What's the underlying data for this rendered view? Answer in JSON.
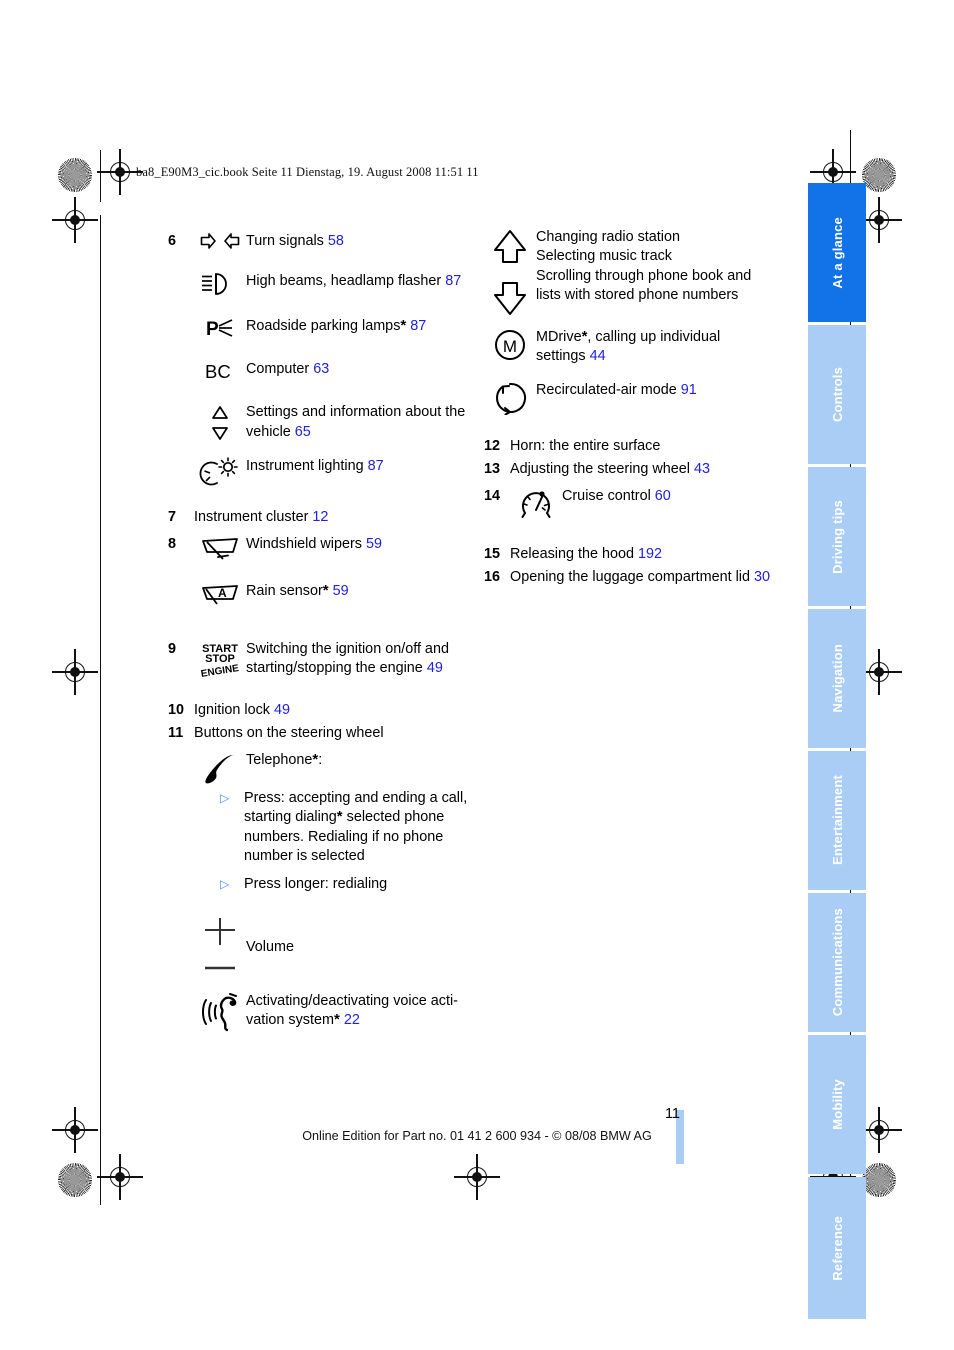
{
  "header": {
    "file_line": "ba8_E90M3_cic.book  Seite 11  Dienstag, 19. August 2008  11:51 11"
  },
  "sidebar": {
    "tabs": [
      {
        "label": "At a glance",
        "active": true
      },
      {
        "label": "Controls",
        "active": false
      },
      {
        "label": "Driving tips",
        "active": false
      },
      {
        "label": "Navigation",
        "active": false
      },
      {
        "label": "Entertainment",
        "active": false
      },
      {
        "label": "Communications",
        "active": false
      },
      {
        "label": "Mobility",
        "active": false
      },
      {
        "label": "Reference",
        "active": false
      }
    ],
    "active_color": "#1272e8",
    "inactive_color": "#a9cdf5",
    "label_color": "#ffffff"
  },
  "left_column": {
    "items": [
      {
        "number": "6",
        "icon": "turn-signals-icon",
        "text": "Turn signals",
        "page": "58"
      },
      {
        "number": "",
        "icon": "high-beams-icon",
        "text": "High beams, headlamp flasher",
        "page": "87"
      },
      {
        "number": "",
        "icon": "roadside-parking-lamps-icon",
        "text": "Roadside parking lamps",
        "starred": true,
        "page": "87"
      },
      {
        "number": "",
        "icon": "bc-computer-icon",
        "text": "Computer",
        "page": "63"
      },
      {
        "number": "",
        "icon": "up-down-triangles-icon",
        "text": "Settings and information about the vehicle",
        "page": "65"
      },
      {
        "number": "",
        "icon": "instrument-lighting-icon",
        "text": "Instrument lighting",
        "page": "87"
      },
      {
        "number": "7",
        "icon": "",
        "text": "Instrument cluster",
        "page": "12"
      },
      {
        "number": "8",
        "icon": "windshield-wipers-icon",
        "text": "Windshield wipers",
        "page": "59"
      },
      {
        "number": "",
        "icon": "rain-sensor-icon",
        "text": "Rain sensor",
        "starred": true,
        "page": "59"
      },
      {
        "number": "9",
        "icon": "start-stop-engine-icon",
        "text": "Switching the ignition on/off and starting/stopping the engine",
        "page": "49"
      },
      {
        "number": "10",
        "icon": "",
        "text": "Ignition lock",
        "page": "49"
      },
      {
        "number": "11",
        "icon": "",
        "text": "Buttons on the steering wheel",
        "page": ""
      }
    ],
    "telephone": {
      "icon": "telephone-handset-icon",
      "label": "Telephone",
      "starred": true,
      "bullets": [
        {
          "marker": "▷",
          "text_part1": "Press: accepting and ending a call, starting dialing",
          "starred": true,
          "text_part2": " selected phone numbers. Redialing if no phone number is selected"
        },
        {
          "marker": "▷",
          "text_part1": "Press longer: redialing",
          "starred": false,
          "text_part2": ""
        }
      ]
    },
    "volume": {
      "icon": "plus-minus-volume-icon",
      "text": "Volume"
    },
    "voice": {
      "icon": "voice-activation-icon",
      "text": "Activating/deactivating voice acti-vation system",
      "text_line1": "Activating/deactivating voice acti-",
      "text_line2": "vation system",
      "starred": true,
      "page": "22"
    }
  },
  "right_column": {
    "arrows": {
      "icon_up": "arrow-up-icon",
      "icon_down": "arrow-down-icon",
      "lines": [
        "Changing radio station",
        "Selecting music track",
        "Scrolling through phone book and",
        "lists with stored phone numbers"
      ]
    },
    "mdrive": {
      "icon": "mdrive-m-circle-icon",
      "text_line1": "MDrive",
      "starred": true,
      "text_line1b": ", calling up individual",
      "text_line2": "settings",
      "page": "44"
    },
    "recirculation": {
      "icon": "recirculated-air-icon",
      "text": "Recirculated-air mode",
      "page": "91"
    },
    "items": [
      {
        "number": "12",
        "icon": "",
        "text": "Horn: the entire surface",
        "page": ""
      },
      {
        "number": "13",
        "icon": "",
        "text": "Adjusting the steering wheel",
        "page": "43"
      },
      {
        "number": "14",
        "icon": "cruise-control-icon",
        "text": "Cruise control",
        "page": "60"
      },
      {
        "number": "15",
        "icon": "",
        "text": "Releasing the hood",
        "page": "192"
      },
      {
        "number": "16",
        "icon": "",
        "text": "Opening the luggage compartment lid",
        "page": "30"
      }
    ]
  },
  "footer": {
    "page_number": "11",
    "edition": "Online Edition for Part no. 01 41 2 600 934 - © 08/08 BMW AG"
  },
  "colors": {
    "page_ref_blue": "#2020dd",
    "bullet_blue": "#4a90e8"
  }
}
